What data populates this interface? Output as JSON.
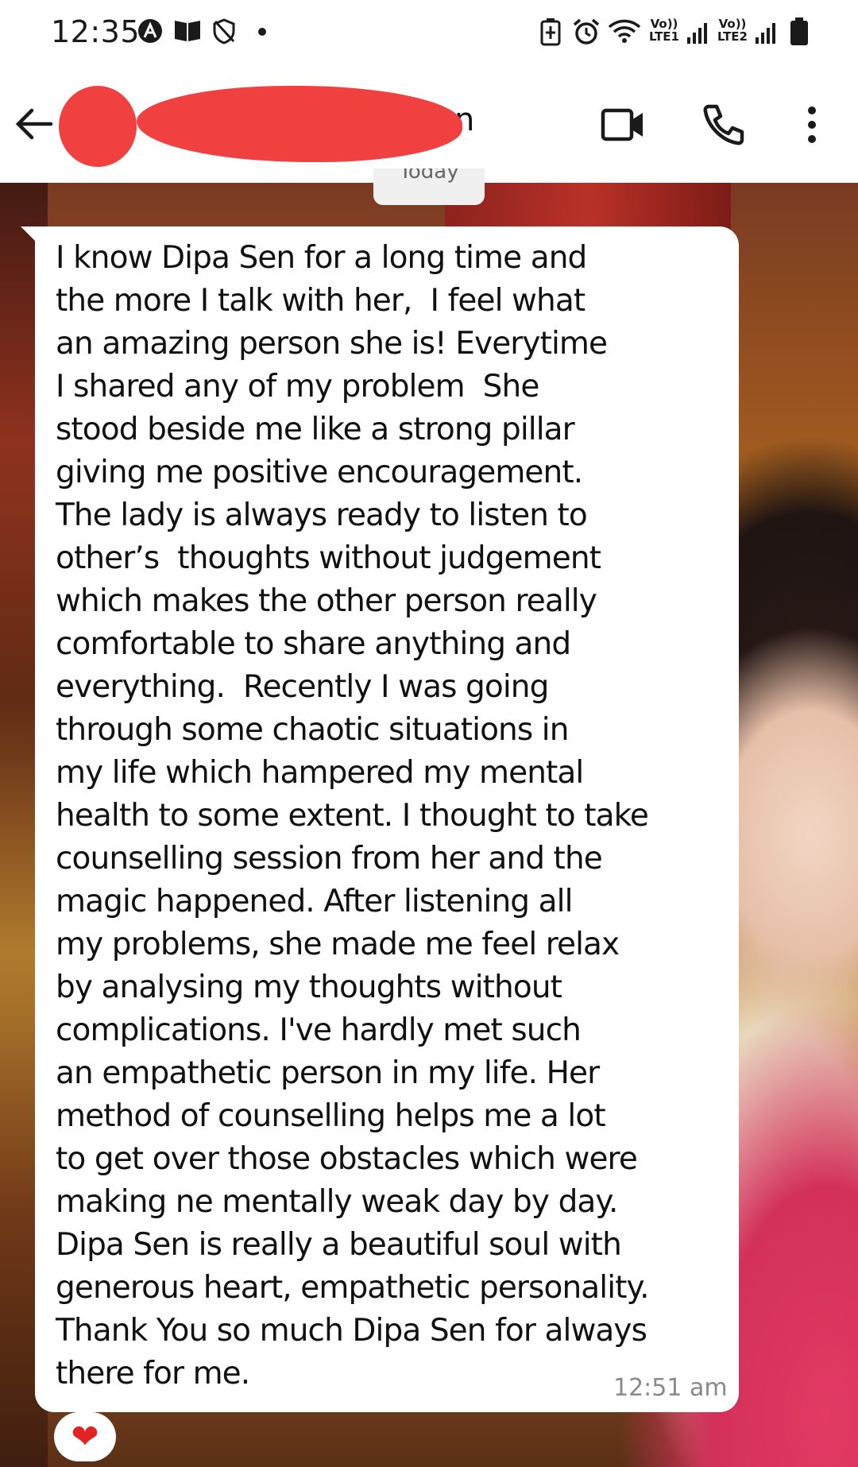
{
  "status_bar": {
    "time": "12:35",
    "left_icons": [
      "a-circle-icon",
      "book-icon",
      "shield-off-icon",
      "dot-icon"
    ],
    "right_icons": [
      "battery-saver-icon",
      "alarm-icon",
      "wifi-icon",
      "signal-icon",
      "battery-icon"
    ],
    "network_1": "Vo)) LTE1",
    "network_2": "Vo)) LTE2"
  },
  "header": {
    "contact_name_visible": "n",
    "back_icon": "arrow-left-icon",
    "video_icon": "video-call-icon",
    "call_icon": "phone-icon",
    "menu_icon": "more-vertical-icon"
  },
  "chat": {
    "date_chip": "Today",
    "message": {
      "text": "I know Dipa Sen for a long time and\nthe more I talk with her,  I feel what\nan amazing person she is! Everytime\nI shared any of my problem  She\nstood beside me like a strong pillar\ngiving me positive encouragement.\nThe lady is always ready to listen to\nother’s  thoughts without judgement\nwhich makes the other person really\ncomfortable to share anything and\neverything.  Recently I was going\nthrough some chaotic situations in\nmy life which hampered my mental\nhealth to some extent. I thought to take\ncounselling session from her and the\nmagic happened. After listening all\nmy problems, she made me feel relax\nby analysing my thoughts without\ncomplications. I've hardly met such\nan empathetic person in my life. Her\nmethod of counselling helps me a lot\nto get over those obstacles which were\nmaking ne mentally weak day by day.\nDipa Sen is really a beautiful soul with\ngenerous heart, empathetic personality.\nThank You so much Dipa Sen for always\nthere for me.",
      "time": "12:51 am",
      "reaction": "❤"
    }
  },
  "colors": {
    "redaction": "#f04040",
    "reaction": "#e02424",
    "bubble": "#ffffff",
    "timestamp": "#8a8a8a"
  }
}
